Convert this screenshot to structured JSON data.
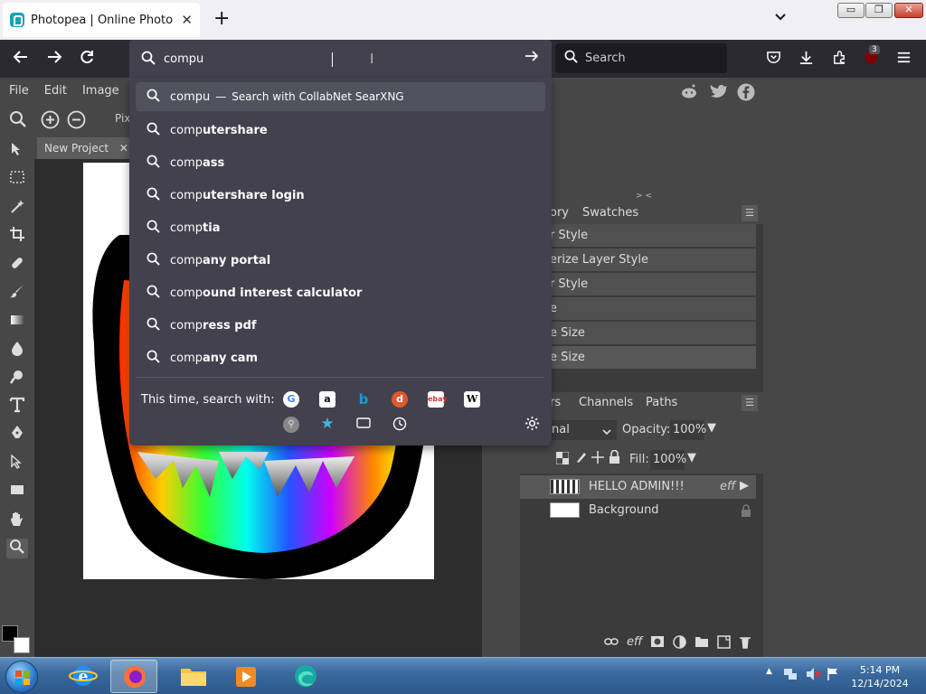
{
  "browser": {
    "tab_title": "Photopea | Online Photo Editor",
    "tab_close": "✕",
    "new_tab": "+",
    "url_value": "compu",
    "search_placeholder": "Search",
    "badge_count": "3"
  },
  "window_controls": {
    "minimize": "▭",
    "maximize": "❐",
    "close": "✕"
  },
  "photopea": {
    "menu": [
      "File",
      "Edit",
      "Image"
    ],
    "option_label": "Pix",
    "doc_tab": "New Project",
    "doc_tab_close": "✕",
    "history_tabs": {
      "partial": "ory",
      "swatches": "Swatches"
    },
    "history_items": [
      "r Style",
      "erize Layer Style",
      "r Style",
      "e",
      "e Size",
      "e Size"
    ],
    "layers_tabs": {
      "partial": "rs",
      "channels": "Channels",
      "paths": "Paths"
    },
    "blend_mode": "nal",
    "opacity_label": "Opacity:",
    "opacity_value": "100%",
    "fill_label": "Fill:",
    "fill_value": "100%",
    "layers": [
      {
        "name": "HELLO ADMIN!!!",
        "effect": "eff"
      },
      {
        "name": "Background"
      }
    ],
    "collapse_handle": "> <"
  },
  "dropdown": {
    "typed": "compu",
    "search_with_sep": "—",
    "search_with_text": "Search with CollabNet SearXNG",
    "suggestions": [
      {
        "prefix": "comp",
        "rest": "utershare"
      },
      {
        "prefix": "comp",
        "rest": "ass"
      },
      {
        "prefix": "comp",
        "rest": "utershare login"
      },
      {
        "prefix": "comp",
        "rest": "tia"
      },
      {
        "prefix": "comp",
        "rest": "any portal"
      },
      {
        "prefix": "comp",
        "rest": "ound interest calculator"
      },
      {
        "prefix": "comp",
        "rest": "ress pdf"
      },
      {
        "prefix": "comp",
        "rest": "any cam"
      }
    ],
    "one_off_label": "This time, search with:"
  },
  "taskbar": {
    "time": "5:14 PM",
    "date": "12/14/2024"
  },
  "colors": {
    "urlbar_bg": "#42414d",
    "firefox_toolbar": "#2b2a33",
    "photopea_panel": "#474747",
    "canvas_bg": "#ffffff"
  },
  "icons": [
    "search-icon",
    "arrow-right-icon",
    "back-icon",
    "forward-icon",
    "reload-icon",
    "pocket-icon",
    "download-icon",
    "extensions-icon",
    "ublock-icon",
    "hamburger-menu-icon",
    "gear-icon"
  ]
}
